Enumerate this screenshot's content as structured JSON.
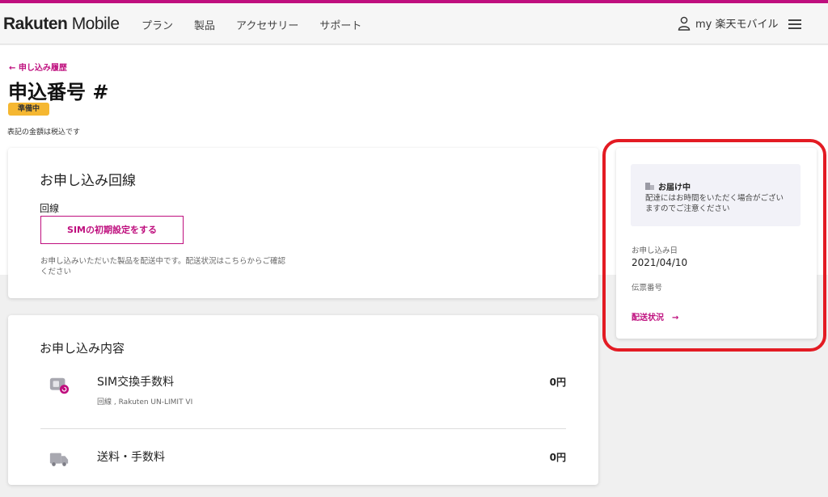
{
  "header": {
    "logo_bold": "Rakuten",
    "logo_light": " Mobile",
    "nav": [
      "プラン",
      "製品",
      "アクセサリー",
      "サポート"
    ],
    "user_label": "my 楽天モバイル",
    "accent": "#bf0f7e"
  },
  "page": {
    "back_label": "← 申し込み履歴",
    "title": "申込番号 #",
    "status": "準備中",
    "tax_note": "表記の金額は税込です"
  },
  "line_card": {
    "title": "お申し込み回線",
    "label": "回線",
    "sim_button": "SIMの初期設定をする",
    "note": "お申し込みいただいた製品を配送中です。配送状況はこちらからご確認ください"
  },
  "order_card": {
    "title": "お申し込み内容",
    "items": [
      {
        "name": "SIM交換手数料",
        "sub": "回線                          , Rakuten UN-LIMIT VI",
        "price": "0円",
        "icon": "sim-card-icon"
      },
      {
        "name": "送料・手数料",
        "sub": "",
        "price": "0円",
        "icon": "truck-icon"
      }
    ]
  },
  "side": {
    "delivery_head": "お届け中",
    "delivery_desc": "配達にはお時間をいただく場合がございますのでご注意ください",
    "order_date_label": "お申し込み日",
    "order_date": "2021/04/10",
    "tracking_label": "伝票番号",
    "ship_status": "配送状況　→"
  }
}
